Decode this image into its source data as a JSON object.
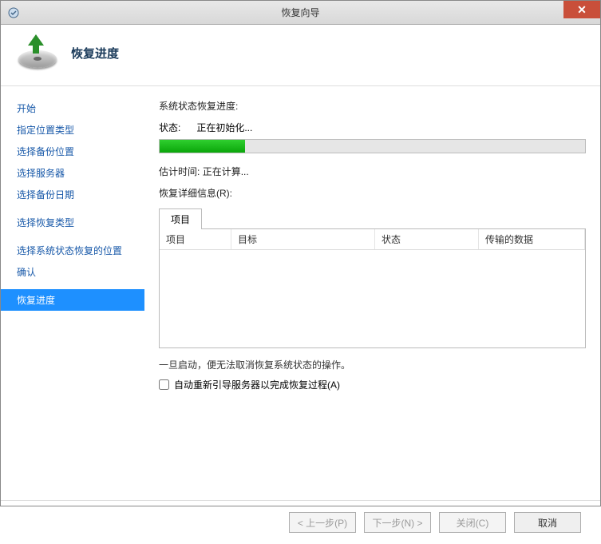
{
  "window": {
    "title": "恢复向导"
  },
  "header": {
    "title": "恢复进度"
  },
  "sidebar": {
    "items": [
      {
        "label": "开始"
      },
      {
        "label": "指定位置类型"
      },
      {
        "label": "选择备份位置"
      },
      {
        "label": "选择服务器"
      },
      {
        "label": "选择备份日期"
      },
      {
        "label": "选择恢复类型"
      },
      {
        "label": "选择系统状态恢复的位置"
      },
      {
        "label": "确认"
      },
      {
        "label": "恢复进度"
      }
    ]
  },
  "main": {
    "section_label": "系统状态恢复进度:",
    "status_label": "状态:",
    "status_value": "正在初始化...",
    "estimate_label": "估计时间:",
    "estimate_value": "正在计算...",
    "details_label": "恢复详细信息(R):",
    "tab_label": "项目",
    "columns": {
      "c1": "项目",
      "c2": "目标",
      "c3": "状态",
      "c4": "传输的数据"
    },
    "warning": "一旦启动，便无法取消恢复系统状态的操作。",
    "checkbox_label": "自动重新引导服务器以完成恢复过程(A)"
  },
  "footer": {
    "prev": "< 上一步(P)",
    "next": "下一步(N) >",
    "close": "关闭(C)",
    "cancel": "取消"
  }
}
